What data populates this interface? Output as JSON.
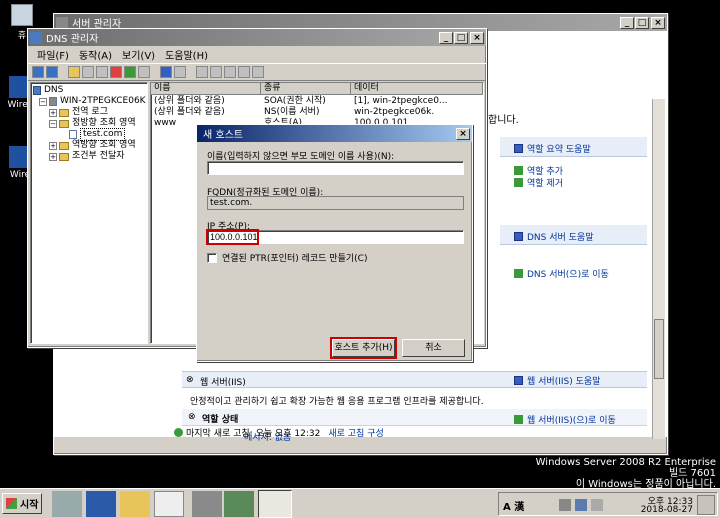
{
  "desktop": {
    "icons": [
      {
        "label": "휴"
      },
      {
        "label": "Wires"
      },
      {
        "label": "Wire"
      }
    ],
    "watermark": {
      "line1": "Windows Server 2008 R2 Enterprise",
      "line2": "빌드 7601",
      "line3": "이 Windows는 정품이 아닙니다."
    }
  },
  "server_manager": {
    "title": "서버 관리자",
    "partial_text": "합니다.",
    "links": {
      "role_summary_help": "역할 요약 도움말",
      "add_roles": "역할 추가",
      "remove_roles": "역할 제거",
      "dns_help": "DNS 서버 도움말",
      "goto_dns": "DNS 서버(으)로 이동",
      "iis_help": "웹 서버(IIS) 도움말",
      "goto_iis": "웹 서버(IIS)(으)로 이동"
    },
    "iis_section": {
      "title": "웹 서버(IIS)",
      "description": "안정적이고 관리하기 쉽고 확장 가능한 웹 응용 프로그램 인프라를 제공합니다.",
      "role_status": "역할 상태",
      "message": "메시지: 없음"
    },
    "status_bar": {
      "last_refresh": "마지막 새로 고침: 오늘 오후 12:32",
      "refresh_settings": "새로 고침 구성"
    }
  },
  "dns_manager": {
    "title": "DNS 관리자",
    "menu": [
      "파일(F)",
      "동작(A)",
      "보기(V)",
      "도움말(H)"
    ],
    "tree": [
      {
        "label": "DNS",
        "level": 0
      },
      {
        "label": "WIN-2TPEGKCE06K",
        "level": 1
      },
      {
        "label": "전역 로그",
        "level": 2
      },
      {
        "label": "정방향 조회 영역",
        "level": 2
      },
      {
        "label": "test.com",
        "level": 3
      },
      {
        "label": "역방향 조회 영역",
        "level": 2
      },
      {
        "label": "조건부 전달자",
        "level": 2
      }
    ],
    "columns": [
      "이름",
      "종류",
      "데이터"
    ],
    "records": [
      {
        "name": "(상위 폴더와 같음)",
        "type": "SOA(권한 시작)",
        "data": "[1], win-2tpegkce0..."
      },
      {
        "name": "(상위 폴더와 같음)",
        "type": "NS(이름 서버)",
        "data": "win-2tpegkce06k."
      },
      {
        "name": "www",
        "type": "호스트(A)",
        "data": "100.0.0.101"
      }
    ]
  },
  "new_host_dialog": {
    "title": "새 호스트",
    "name_label": "이름(입력하지 않으면 부모 도메인 이름 사용)(N):",
    "name_value": "",
    "fqdn_label": "FQDN(정규화된 도메인 이름):",
    "fqdn_value": "test.com.",
    "ip_label": "IP 주소(P):",
    "ip_value": "100.0.0.101",
    "ptr_label": "연결된 PTR(포인터) 레코드 만들기(C)",
    "ptr_checked": false,
    "add_button": "호스트 추가(H)",
    "cancel_button": "취소",
    "highlight_color": "#cc0000"
  },
  "taskbar": {
    "start": "시작",
    "tray": {
      "lang": "A 漢",
      "time": "오후 12:33",
      "date": "2018-08-27"
    }
  }
}
